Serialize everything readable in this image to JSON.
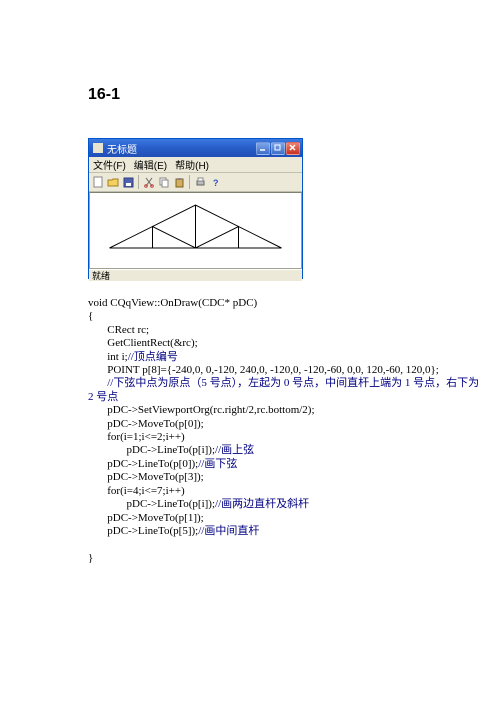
{
  "heading": "16-1",
  "window": {
    "title": "无标题",
    "menu": [
      "文件(F)",
      "编辑(E)",
      "帮助(H)"
    ],
    "status": "就绪"
  },
  "code": {
    "l1": "void CQqView::OnDraw(CDC* pDC)",
    "l2": "{",
    "l3": "       CRect rc;",
    "l4": "       GetClientRect(&rc);",
    "l5a": "       int i;",
    "l5b": "//顶点编号",
    "l6": "       POINT p[8]={-240,0, 0,-120, 240,0, -120,0, -120,-60, 0,0, 120,-60, 120,0};",
    "l7a": "       ",
    "l7b": "//下弦中点为原点（",
    "l7c": "5",
    "l7d": " 号点），左起为 ",
    "l7e": "0",
    "l7f": " 号点，中间直杆上端为 ",
    "l7g": "1",
    "l7h": " 号点，右下为",
    "l8a": "2",
    "l8b": " 号点",
    "l9": "       pDC->SetViewportOrg(rc.right/2,rc.bottom/2);",
    "l10": "       pDC->MoveTo(p[0]);",
    "l11": "       for(i=1;i<=2;i++)",
    "l12a": "              pDC->LineTo(p[i]);",
    "l12b": "//画上弦",
    "l13a": "       pDC->LineTo(p[0]);",
    "l13b": "//画下弦",
    "l14": "       pDC->MoveTo(p[3]);",
    "l15": "       for(i=4;i<=7;i++)",
    "l16a": "              pDC->LineTo(p[i]);",
    "l16b": "//画两边直杆及斜杆",
    "l17": "       pDC->MoveTo(p[1]);",
    "l18a": "       pDC->LineTo(p[5]);",
    "l18b": "//画中间直杆",
    "l19": "",
    "l20": "}"
  }
}
